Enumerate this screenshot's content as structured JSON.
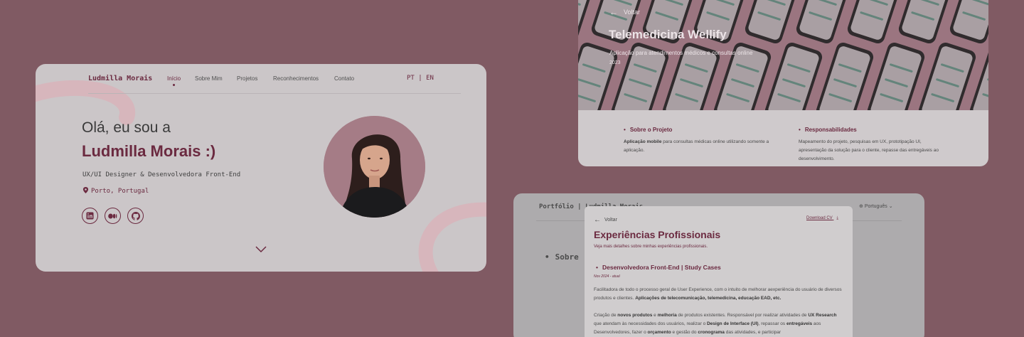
{
  "hero_card": {
    "brand": "Ludmilla Morais",
    "nav": [
      "Início",
      "Sobre Mim",
      "Projetos",
      "Reconhecimentos",
      "Contato"
    ],
    "lang": "PT | EN",
    "greeting": "Olá, eu sou a",
    "name": "Ludmilla Morais :)",
    "role": "UX/UI Designer & Desenvolvedora Front-End",
    "location": "Porto, Portugal",
    "social_icons": [
      "linkedin-icon",
      "medium-icon",
      "github-icon"
    ],
    "scroll_icon": "chevron-down-icon"
  },
  "project_card": {
    "back_label": "Voltar",
    "title": "Telemedicina Wellify",
    "subtitle": "Aplicação para atendimentos médicos e consultas online",
    "year": "2023",
    "about_heading": "Sobre o Projeto",
    "about_bold": "Aplicação mobile",
    "about_text": " para consultas médicas online utilizando somente a aplicação.",
    "resp_heading": "Responsabilidades",
    "resp_text": "Mapeamento do projeto, pesquisas em UX, prototipação UI, apresentação da solução para o cliente, repasse das entregáveis ao desenvolvimento."
  },
  "portfolio_card": {
    "brand": "Portfólio | Ludmilla Morais",
    "language": "Português",
    "section": "Sobre"
  },
  "experience_modal": {
    "back_label": "Voltar",
    "download_label": "Download CV",
    "title": "Experiências Profissionais",
    "subtitle": "Veja mais detalhes sobre minhas experiências profissionais.",
    "job_title": "Desenvolvedora Front-End | Study Cases",
    "job_date": "Nov 2024 - atual",
    "p1_a": "Facilitadora de todo o processo geral de User Experience, com o intuito de melhorar aexperiência do usuário de diversos produtos e clientes. ",
    "p1_b": "Aplicações de telecomunicação, telemedicina, educação EAD, etc.",
    "p2_a": "Criação de ",
    "p2_b": "novos produtos",
    "p2_c": " e ",
    "p2_d": "melhoria",
    "p2_e": " de produtos existentes. Responsável por realizar atividades de ",
    "p2_f": "UX Research",
    "p2_g": " que atendam às necessidades dos usuários, realizar o ",
    "p2_h": "Design de Interface (UI)",
    "p2_i": ", repassar os ",
    "p2_j": "entregáveis",
    "p2_k": " aos Desenvolvedores, fazer o ",
    "p2_l": "orçamento",
    "p2_m": " e gestão do ",
    "p2_n": "cronograma",
    "p2_o": " das atividades, e participar"
  },
  "colors": {
    "background": "#805a63",
    "accent": "#6b2a40"
  }
}
